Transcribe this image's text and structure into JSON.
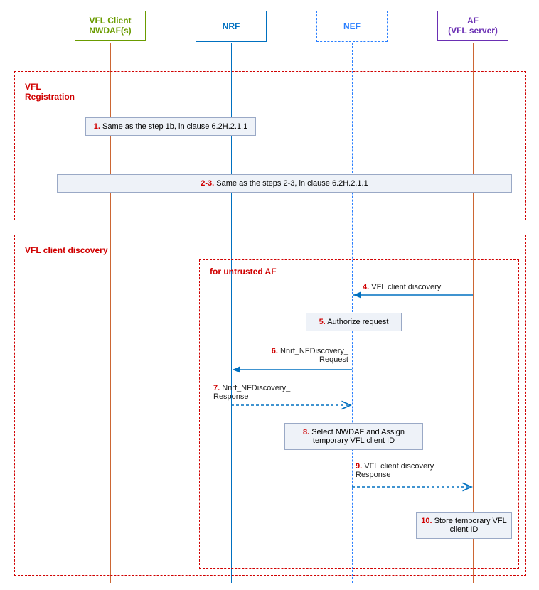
{
  "participants": {
    "p1": {
      "line1": "VFL Client",
      "line2": "NWDAF(s)"
    },
    "p2": {
      "label": "NRF"
    },
    "p3": {
      "label": "NEF"
    },
    "p4": {
      "line1": "AF",
      "line2": "(VFL server)"
    }
  },
  "phases": {
    "registration": "VFL\nRegistration",
    "discovery": "VFL client discovery",
    "untrusted": "for untrusted AF"
  },
  "steps": {
    "s1": {
      "num": "1.",
      "text": " Same as the step 1b, in clause 6.2H.2.1.1"
    },
    "s23": {
      "num": "2-3.",
      "text": " Same as the steps 2-3, in clause 6.2H.2.1.1"
    },
    "s4": {
      "num": "4.",
      "text": " VFL client discovery"
    },
    "s5": {
      "num": "5.",
      "text": " Authorize request"
    },
    "s6": {
      "num": "6.",
      "text": " Nnrf_NFDiscovery_ Request"
    },
    "s7": {
      "num": "7.",
      "text": " Nnrf_NFDiscovery_ Response"
    },
    "s8": {
      "num": "8.",
      "text": " Select NWDAF and Assign temporary VFL client ID"
    },
    "s9": {
      "num": "9.",
      "text": " VFL client discovery Response"
    },
    "s10": {
      "num": "10.",
      "text": " Store temporary VFL client ID"
    }
  }
}
